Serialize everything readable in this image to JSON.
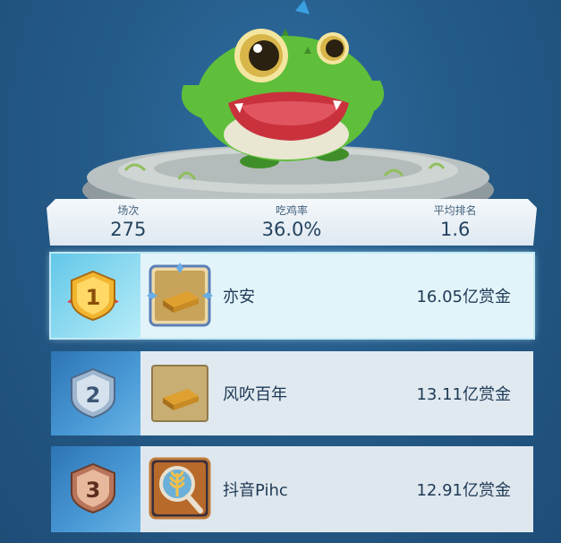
{
  "stats": [
    {
      "label": "场次",
      "value": "275"
    },
    {
      "label": "吃鸡率",
      "value": "36.0%"
    },
    {
      "label": "平均排名",
      "value": "1.6"
    }
  ],
  "leaderboard": [
    {
      "rank": "1",
      "name": "亦安",
      "prize": "16.05亿赏金",
      "item_icon": "gold-bar-icon"
    },
    {
      "rank": "2",
      "name": "风吹百年",
      "prize": "13.11亿赏金",
      "item_icon": "gold-bar-icon"
    },
    {
      "rank": "3",
      "name": "抖音Pihc",
      "prize": "12.91亿赏金",
      "item_icon": "wheat-magnifier-icon"
    }
  ],
  "colors": {
    "background": "#255b88",
    "mascot": "#5fbf3a",
    "gold_medal": "#f2b530",
    "silver_medal": "#9fb6cf",
    "bronze_medal": "#b8755a"
  }
}
